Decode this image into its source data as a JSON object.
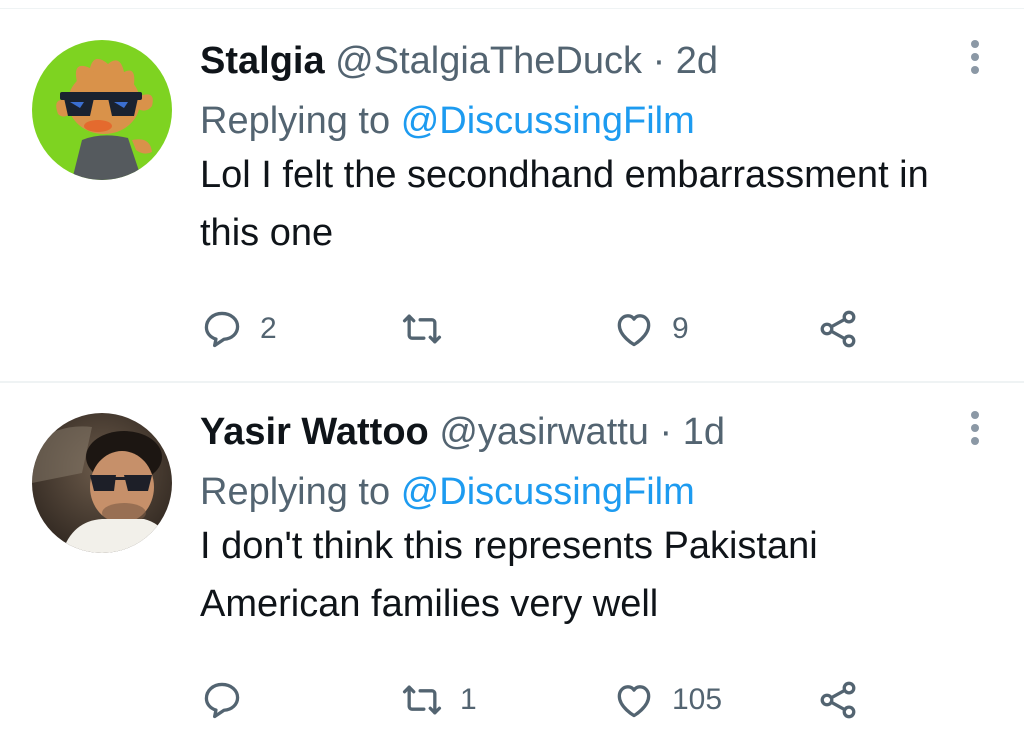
{
  "tweets": [
    {
      "name": "Stalgia",
      "handle": "@StalgiaTheDuck",
      "separator": "·",
      "time": "2d",
      "replying_label": "Replying to",
      "replying_to": "@DiscussingFilm",
      "text": "Lol I felt the secondhand embarrassment in this one",
      "reply_count": "2",
      "retweet_count": "",
      "like_count": "9",
      "avatar_icon": "duck-avatar",
      "avatar_bg": "#7ed321"
    },
    {
      "name": "Yasir Wattoo",
      "handle": "@yasirwattu",
      "separator": "·",
      "time": "1d",
      "replying_label": "Replying to",
      "replying_to": "@DiscussingFilm",
      "text": "I don't think this represents Pakistani American families very well",
      "reply_count": "",
      "retweet_count": "1",
      "like_count": "105",
      "avatar_icon": "photo-avatar"
    }
  ],
  "colors": {
    "mention": "#1d9bf0",
    "secondary_text": "#536471",
    "divider": "#eff3f4"
  },
  "icons": [
    "reply-icon",
    "retweet-icon",
    "like-icon",
    "share-icon",
    "more-options-icon"
  ]
}
